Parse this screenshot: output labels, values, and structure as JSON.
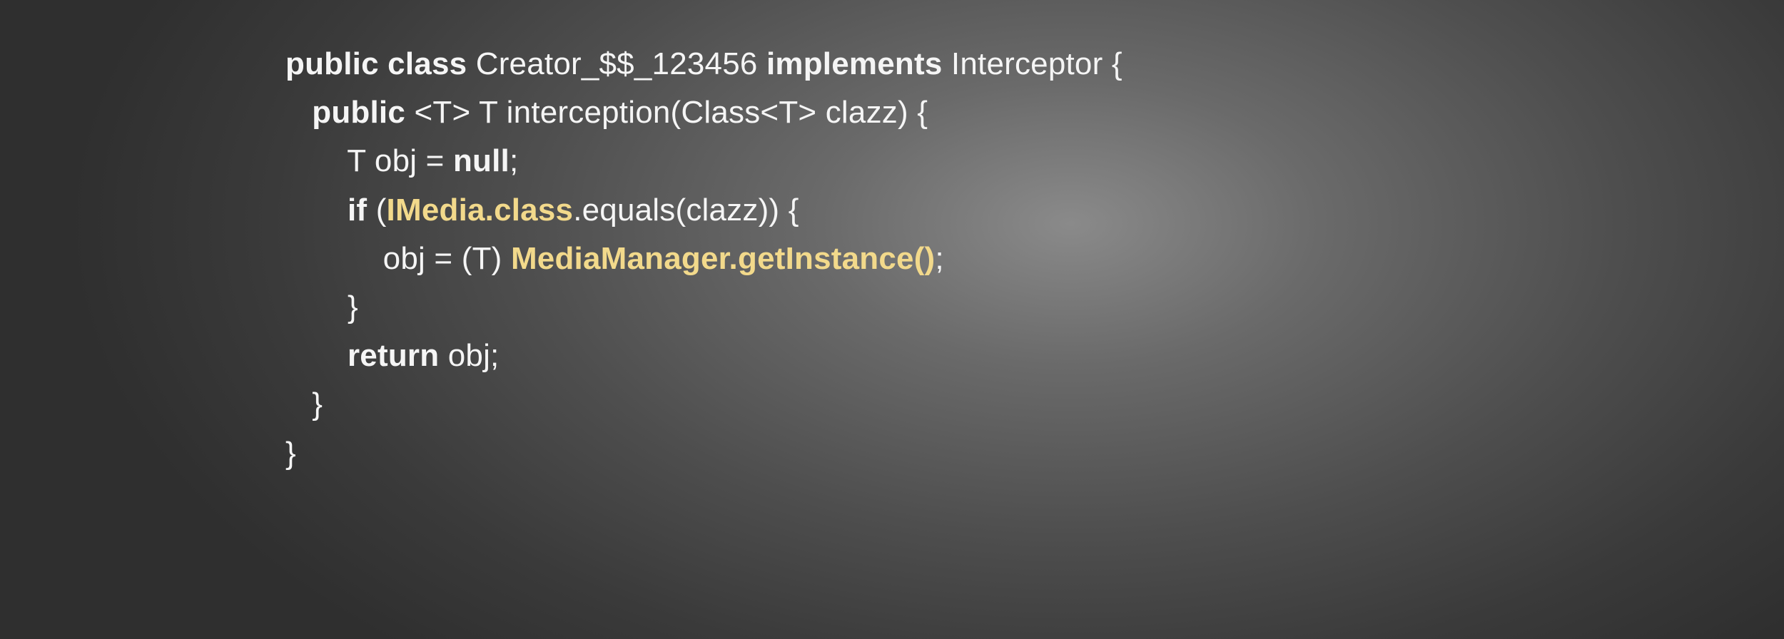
{
  "code": {
    "line1": {
      "t1": "public class",
      "t2": " Creator_$$_123456 ",
      "t3": "implements",
      "t4": " Interceptor {"
    },
    "line2": {
      "indent": "   ",
      "t1": "public",
      "t2": " <T> T interception(Class<T> clazz) {"
    },
    "line3": {
      "indent": "       ",
      "t1": "T obj = ",
      "t2": "null",
      "t3": ";"
    },
    "line4": {
      "indent": "       ",
      "t1": "if",
      "t2": " (",
      "t3": "IMedia.class",
      "t4": ".equals(clazz)) {"
    },
    "line5": {
      "indent": "           ",
      "t1": "obj = (T) ",
      "t2": "MediaManager.getInstance()",
      "t3": ";"
    },
    "line6": {
      "indent": "       ",
      "t1": "}"
    },
    "line7": {
      "indent": "       ",
      "t1": "return",
      "t2": " obj;"
    },
    "line8": {
      "indent": "   ",
      "t1": "}"
    },
    "line9": {
      "t1": "}"
    }
  }
}
